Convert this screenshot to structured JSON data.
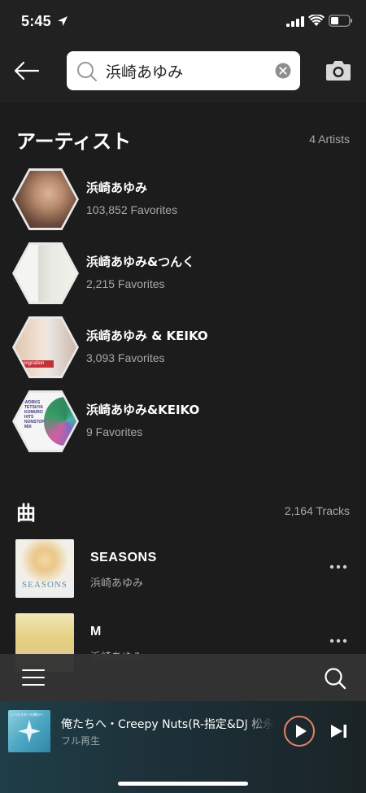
{
  "status_bar": {
    "time": "5:45"
  },
  "search": {
    "query": "浜崎あゆみ"
  },
  "artists_section": {
    "title": "アーティスト",
    "count": "4 Artists",
    "items": [
      {
        "name": "浜崎あゆみ",
        "favorites": "103,852 Favorites"
      },
      {
        "name": "浜崎あゆみ&つんく",
        "favorites": "2,215 Favorites"
      },
      {
        "name": "浜崎あゆみ & KEIKO",
        "favorites": "3,093 Favorites"
      },
      {
        "name": "浜崎あゆみ&KEIKO",
        "favorites": "9 Favorites"
      }
    ]
  },
  "tracks_section": {
    "title": "曲",
    "count": "2,164 Tracks",
    "items": [
      {
        "title": "SEASONS",
        "artist": "浜崎あゆみ",
        "cover_text": "SEASONS"
      },
      {
        "title": "M",
        "artist": "浜崎あゆみ"
      }
    ]
  },
  "artwork_text": {
    "artist3_cover": "songnation",
    "artist4_cover_lines": [
      "WORKS",
      "TETSUYA",
      "KOMURO",
      "HITS",
      "NONSTOP",
      "MIX"
    ]
  },
  "player": {
    "title": "俺たちへ・Creepy Nuts(R-指定&DJ 松永)",
    "subtitle": "フル再生",
    "art_caption": "いつかスターの横のへ"
  },
  "colors": {
    "background": "#1c1c1c",
    "header": "#212121",
    "secondary_text": "#a8a8a8",
    "play_accent": "#e58368"
  },
  "icons": {
    "back": "arrow-left-icon",
    "search": "search-icon",
    "clear": "clear-circle-icon",
    "camera": "camera-icon",
    "more": "more-horizontal-icon",
    "menu": "hamburger-menu-icon",
    "play": "play-icon",
    "next": "skip-next-icon"
  }
}
